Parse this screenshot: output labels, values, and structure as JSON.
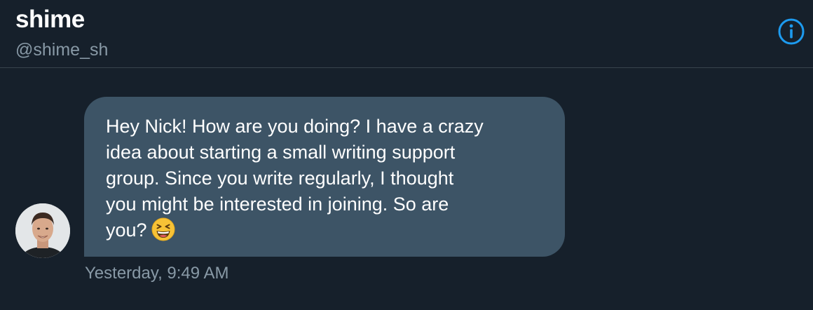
{
  "header": {
    "display_name": "shime",
    "handle": "@shime_sh",
    "info_icon": "info-icon"
  },
  "message": {
    "text_lines": [
      "Hey Nick! How are you doing? I have a crazy",
      "idea about starting a small writing support",
      "group. Since you write regularly, I thought",
      "you might be interested in joining.  So are",
      "you?"
    ],
    "emoji": "grinning-squinting-face",
    "timestamp": "Yesterday, 9:49 AM",
    "sender_avatar": "avatar"
  },
  "colors": {
    "background": "#16202b",
    "bubble": "#3d5466",
    "secondary_text": "#8899a6",
    "accent": "#1d9bf0",
    "divider": "#38444d"
  }
}
